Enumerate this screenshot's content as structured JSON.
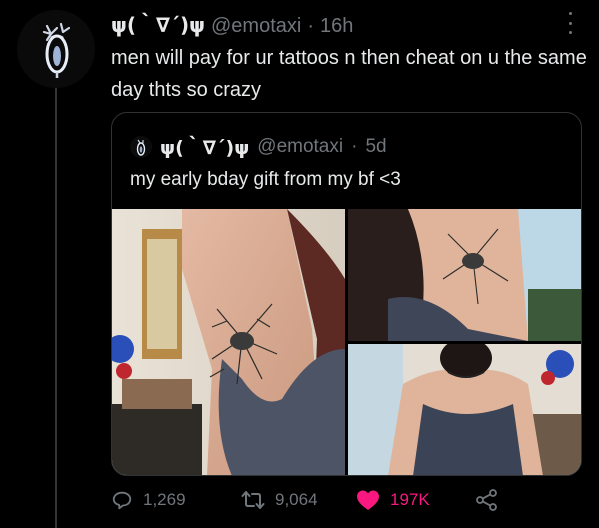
{
  "tweet": {
    "display_name": "ψ(｀∇´)ψ",
    "handle": "@emotaxi",
    "separator": "·",
    "time": "16h",
    "text": "men will pay for ur tattoos n then cheat on u the same day thts so crazy",
    "avatar_icon": "lantern-icon"
  },
  "quoted_tweet": {
    "display_name": "ψ(｀∇´)ψ",
    "handle": "@emotaxi",
    "separator": "·",
    "time": "5d",
    "text": "my early bday gift from my bf <3",
    "images": [
      "armpit-tattoo-photo-1",
      "armpit-tattoo-photo-2",
      "full-body-photo-3"
    ]
  },
  "actions": {
    "replies": "1,269",
    "retweets": "9,064",
    "likes": "197K",
    "liked": true
  },
  "colors": {
    "background": "#000000",
    "text": "#e7e9ea",
    "muted": "#71767b",
    "border": "#2f3336",
    "like": "#f91880"
  }
}
